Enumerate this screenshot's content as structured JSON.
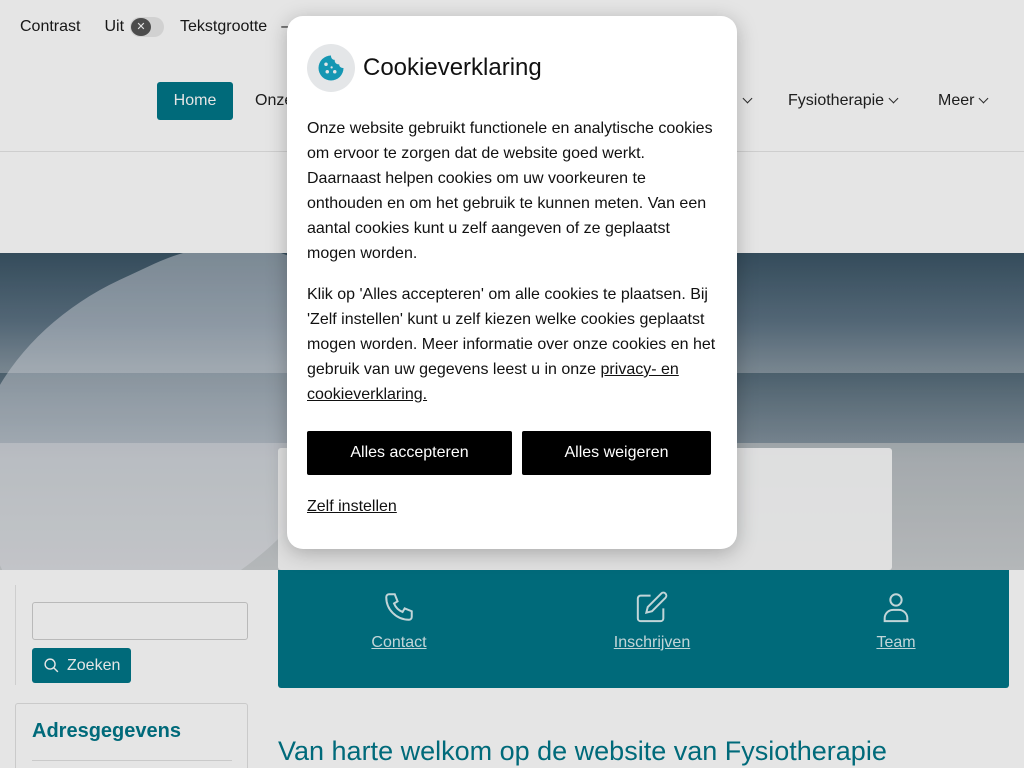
{
  "topbar": {
    "contrast_label": "Contrast",
    "contrast_state": "Uit",
    "textsize_label": "Tekstgrootte",
    "textsize_minus": "–"
  },
  "nav": {
    "home": "Home",
    "partial": "Onze",
    "fysio": "Fysiotherapie",
    "more": "Meer"
  },
  "quicklinks": [
    {
      "label": "Contact",
      "icon": "phone-icon"
    },
    {
      "label": "Inschrijven",
      "icon": "edit-icon"
    },
    {
      "label": "Team",
      "icon": "user-icon"
    }
  ],
  "sidebar": {
    "search_button": "Zoeken",
    "address_title": "Adresgegevens"
  },
  "main": {
    "welcome": "Van harte welkom op de website van Fysiotherapie"
  },
  "cookie": {
    "title": "Cookieverklaring",
    "icon": "cookie-icon",
    "paragraph1": "Onze website gebruikt functionele en analytische cookies om ervoor te zorgen dat de website goed werkt. Daarnaast helpen cookies om uw voorkeuren te onthouden en om het gebruik te kunnen meten. Van een aantal cookies kunt u zelf aangeven of ze geplaatst mogen worden.",
    "paragraph2": "Klik op 'Alles accepteren' om alle cookies te plaatsen. Bij 'Zelf instellen' kunt u zelf kiezen welke cookies geplaatst mogen worden. Meer informatie over onze cookies en het gebruik van uw gegevens leest u in onze ",
    "privacy_link": "privacy- en cookieverklaring.",
    "accept": "Alles accepteren",
    "reject": "Alles weigeren",
    "custom": "Zelf instellen"
  },
  "colors": {
    "accent": "#007688",
    "button": "#000000"
  }
}
